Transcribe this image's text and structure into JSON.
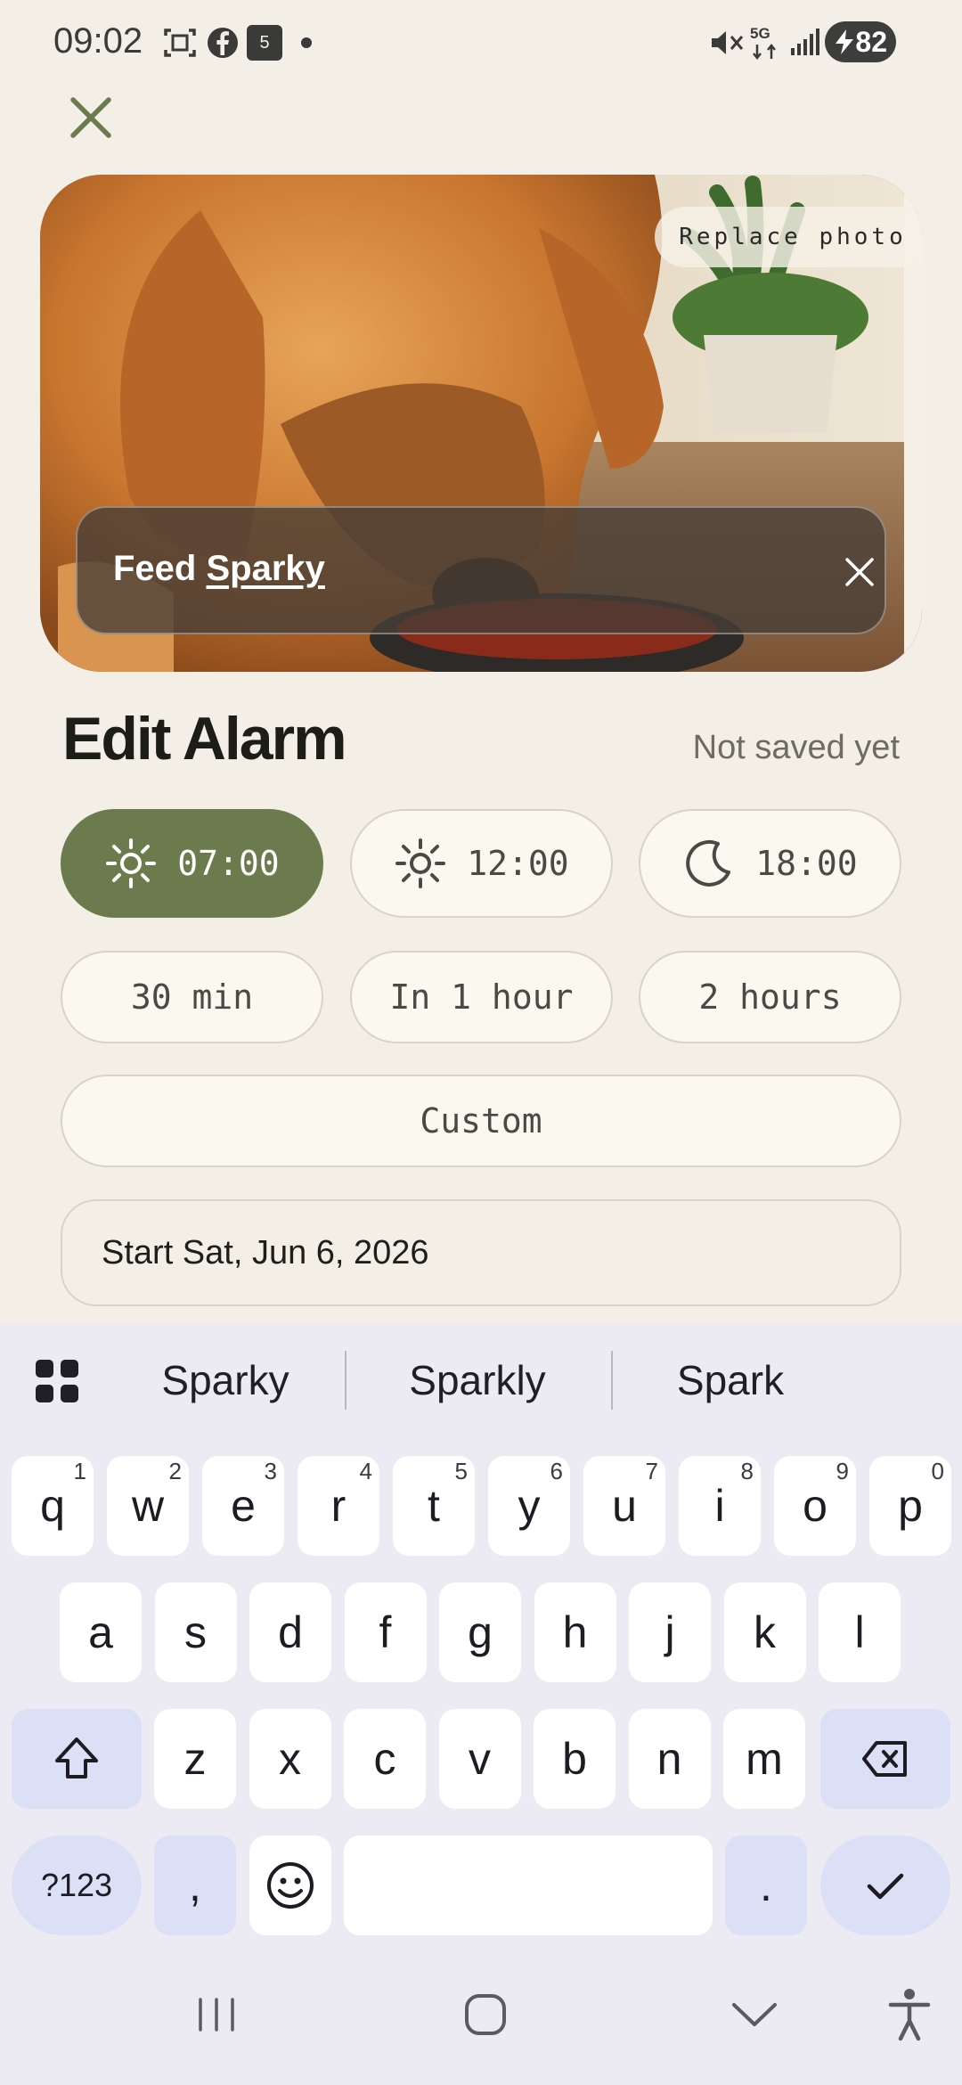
{
  "status_bar": {
    "time": "09:02",
    "battery": "82",
    "icons": [
      "screenshot-icon",
      "facebook-icon",
      "calendar-icon",
      "dot-icon",
      "mute-icon",
      "5g-icon",
      "signal-icon",
      "battery-icon"
    ],
    "calendar_day": "5",
    "network": "5G"
  },
  "photo": {
    "replace_label": "Replace photo",
    "title_prefix": "Feed",
    "title_word": "Sparky"
  },
  "header": {
    "title": "Edit Alarm",
    "save_state": "Not saved yet"
  },
  "times": [
    {
      "label": "07:00",
      "icon": "sun-icon",
      "selected": true
    },
    {
      "label": "12:00",
      "icon": "sun-icon",
      "selected": false
    },
    {
      "label": "18:00",
      "icon": "moon-icon",
      "selected": false
    }
  ],
  "offsets": [
    {
      "label": "30 min"
    },
    {
      "label": "In 1 hour"
    },
    {
      "label": "2 hours"
    }
  ],
  "custom_label": "Custom",
  "start_label": "Start Sat, Jun 6, 2026",
  "keyboard": {
    "suggestions": [
      "Sparky",
      "Sparkly",
      "Spark"
    ],
    "row1": [
      {
        "k": "q",
        "n": "1"
      },
      {
        "k": "w",
        "n": "2"
      },
      {
        "k": "e",
        "n": "3"
      },
      {
        "k": "r",
        "n": "4"
      },
      {
        "k": "t",
        "n": "5"
      },
      {
        "k": "y",
        "n": "6"
      },
      {
        "k": "u",
        "n": "7"
      },
      {
        "k": "i",
        "n": "8"
      },
      {
        "k": "o",
        "n": "9"
      },
      {
        "k": "p",
        "n": "0"
      }
    ],
    "row2": [
      "a",
      "s",
      "d",
      "f",
      "g",
      "h",
      "j",
      "k",
      "l"
    ],
    "row3": [
      "z",
      "x",
      "c",
      "v",
      "b",
      "n",
      "m"
    ],
    "symbols_label": "?123",
    "comma": ",",
    "period": "."
  },
  "colors": {
    "accent": "#6c7b4d",
    "background": "#f4efe6",
    "keyboard_bg": "#ecebf3",
    "function_key": "#dbe0f6"
  }
}
